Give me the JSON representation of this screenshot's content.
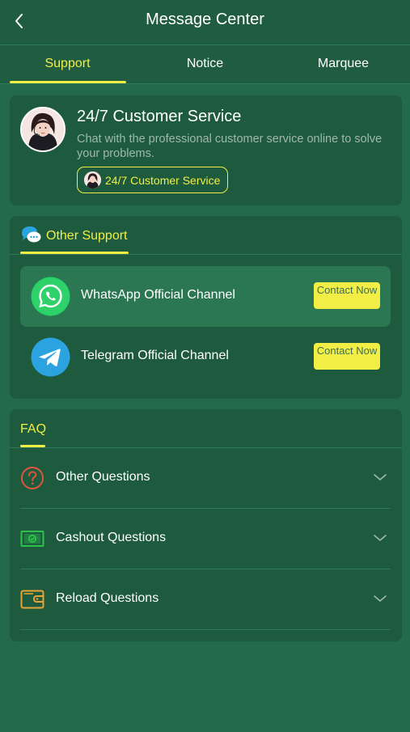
{
  "header": {
    "title": "Message Center"
  },
  "tabs": [
    {
      "label": "Support",
      "active": true
    },
    {
      "label": "Notice",
      "active": false
    },
    {
      "label": "Marquee",
      "active": false
    }
  ],
  "customer_service": {
    "title": "24/7 Customer Service",
    "description": "Chat with the professional customer service online to solve your problems.",
    "button_label": "24/7 Customer Service"
  },
  "other_support": {
    "heading": "Other Support",
    "channels": [
      {
        "name": "WhatsApp Official Channel",
        "button_label": "Contact Now",
        "icon": "whatsapp-icon"
      },
      {
        "name": "Telegram Official Channel",
        "button_label": "Contact Now",
        "icon": "telegram-icon"
      }
    ]
  },
  "faq": {
    "heading": "FAQ",
    "items": [
      {
        "label": "Other Questions",
        "icon": "question-circle-icon"
      },
      {
        "label": "Cashout Questions",
        "icon": "cash-icon"
      },
      {
        "label": "Reload Questions",
        "icon": "wallet-icon"
      }
    ]
  },
  "colors": {
    "background": "#236a4a",
    "card": "#1d5a3e",
    "accent": "#f2ee45",
    "whatsapp": "#25d366",
    "telegram": "#2aa3e0"
  }
}
